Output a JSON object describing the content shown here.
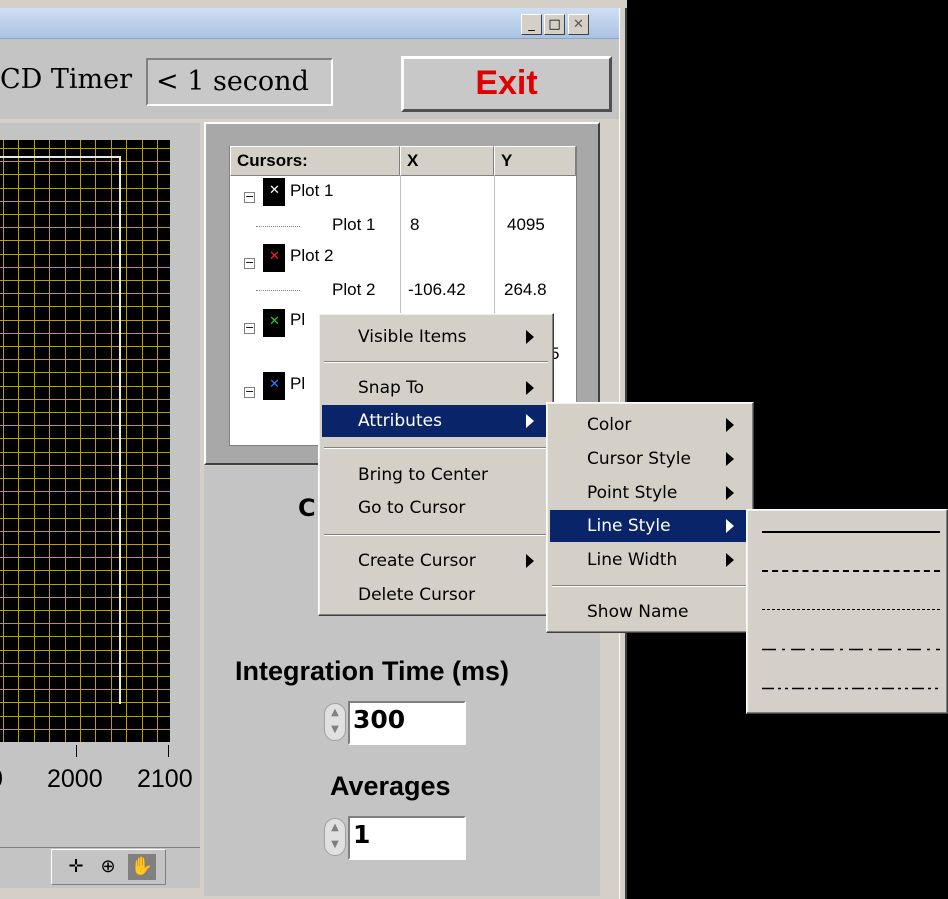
{
  "window": {
    "minimize_glyph": "_",
    "maximize_glyph": "□",
    "close_glyph": "✕"
  },
  "toolbar": {
    "ccd_timer_label": "CD Timer",
    "ccd_timer_value": "< 1 second",
    "exit_label": "Exit"
  },
  "graph": {
    "x_tick_labels": [
      "0",
      "2000",
      "2100"
    ],
    "grid_color": "#b7a000",
    "trace_color": "#e8e8e8"
  },
  "graph_palette": {
    "icons": [
      "crosshair-icon",
      "zoom-icon",
      "pan-hand-icon"
    ]
  },
  "cursors_table": {
    "headers": {
      "name": "Cursors:",
      "x": "X",
      "y": "Y"
    },
    "plots": [
      {
        "name": "Plot 1",
        "child": "Plot 1",
        "x": "8",
        "y": "4095",
        "marker_color": "#ffffff"
      },
      {
        "name": "Plot 2",
        "child": "Plot 2",
        "x": "-106.42",
        "y": "264.8",
        "marker_color": "#ff2020"
      },
      {
        "name": "Pl",
        "child": "",
        "x": "",
        "y": "5",
        "marker_color": "#20d020"
      },
      {
        "name": "Pl",
        "child": "",
        "x": "",
        "y": "",
        "marker_color": "#2080ff"
      }
    ]
  },
  "lower_panel": {
    "partial_letter": "C",
    "integration_label": "Integration Time (ms)",
    "integration_value": "300",
    "averages_label": "Averages",
    "averages_value": "1"
  },
  "context_menu": {
    "visible_items": "Visible Items",
    "snap_to": "Snap To",
    "attributes": "Attributes",
    "bring_to_center": "Bring to Center",
    "go_to_cursor": "Go to Cursor",
    "create_cursor": "Create Cursor",
    "delete_cursor": "Delete Cursor"
  },
  "attributes_submenu": {
    "color": "Color",
    "cursor_style": "Cursor Style",
    "point_style": "Point Style",
    "line_style": "Line Style",
    "line_width": "Line Width",
    "show_name": "Show Name"
  },
  "line_style_submenu": {
    "options": [
      "solid",
      "dashed",
      "dotted",
      "dash-dot",
      "dash-dot-dot"
    ]
  },
  "colors": {
    "menu_highlight": "#0a246a",
    "exit_text": "#e00000"
  }
}
